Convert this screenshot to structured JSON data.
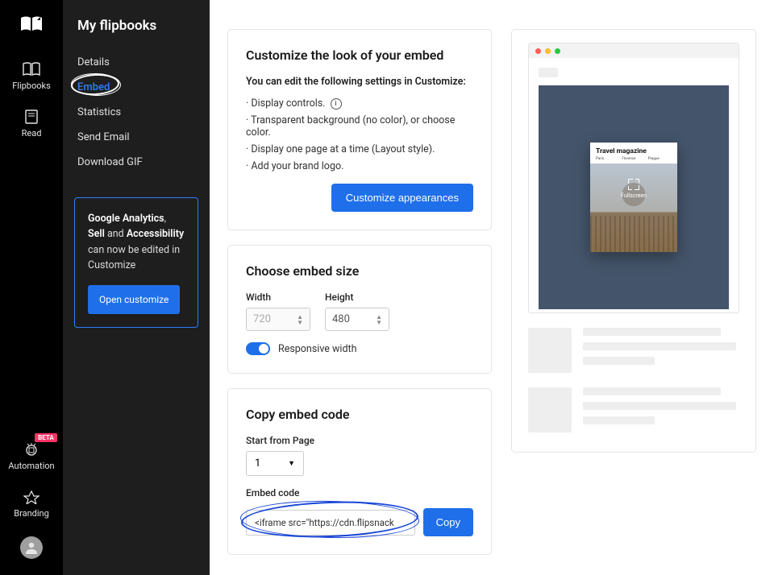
{
  "nav": {
    "items": [
      {
        "label": "Flipbooks"
      },
      {
        "label": "Read"
      }
    ],
    "bottom": [
      {
        "label": "Automation",
        "badge": "BETA"
      },
      {
        "label": "Branding"
      }
    ]
  },
  "sidepanel": {
    "title": "My flipbooks",
    "menu": [
      {
        "label": "Details"
      },
      {
        "label": "Embed",
        "active": true
      },
      {
        "label": "Statistics"
      },
      {
        "label": "Send Email"
      },
      {
        "label": "Download GIF"
      }
    ],
    "infobox": {
      "bold1": "Google Analytics",
      "mid1": ", ",
      "bold2": "Sell",
      "mid2": " and ",
      "bold3": "Accessibility",
      "tail": " can now be edited in Customize",
      "button": "Open customize"
    }
  },
  "cards": {
    "customize": {
      "title": "Customize the look of your embed",
      "lead": "You can edit the following settings in Customize:",
      "items": [
        "Display controls.",
        "Transparent background (no color), or choose color.",
        "Display one page at a time (Layout style).",
        "Add your brand logo."
      ],
      "button": "Customize appearances"
    },
    "size": {
      "title": "Choose embed size",
      "widthLabel": "Width",
      "heightLabel": "Height",
      "width": "720",
      "height": "480",
      "responsive": "Responsive width"
    },
    "copy": {
      "title": "Copy embed code",
      "startLabel": "Start from Page",
      "startValue": "1",
      "embedLabel": "Embed code",
      "embedValue": "<iframe src=\"https://cdn.flipsnack",
      "copyBtn": "Copy"
    }
  },
  "preview": {
    "magTitle": "Travel magazine",
    "cities": [
      "Paris",
      "Florence",
      "Prague"
    ],
    "fullscreen": "Fullscreen"
  },
  "colors": {
    "accent": "#1f6fea"
  }
}
